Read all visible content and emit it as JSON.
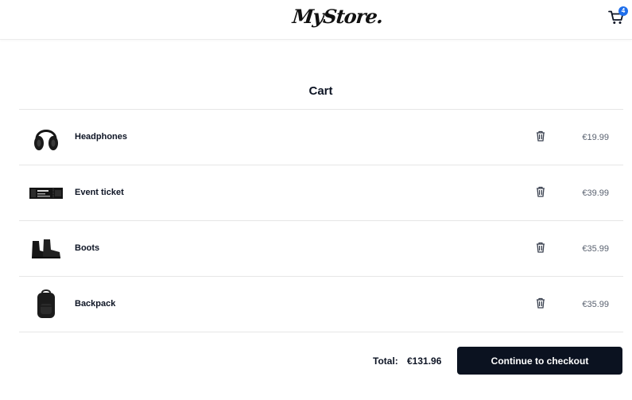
{
  "header": {
    "logo_main": "MyStore",
    "logo_dot": ".",
    "cart_count": "4",
    "cart_icon": "shopping-cart-icon"
  },
  "cart": {
    "title": "Cart",
    "items": [
      {
        "name": "Headphones",
        "price": "€19.99",
        "image": "headphones"
      },
      {
        "name": "Event ticket",
        "price": "€39.99",
        "image": "ticket"
      },
      {
        "name": "Boots",
        "price": "€35.99",
        "image": "boots"
      },
      {
        "name": "Backpack",
        "price": "€35.99",
        "image": "backpack"
      }
    ],
    "remove_icon": "trash-icon"
  },
  "summary": {
    "total_label": "Total:",
    "total_value": "€131.96",
    "checkout_label": "Continue to checkout"
  },
  "colors": {
    "primary_dark": "#0b1220",
    "badge": "#1f6feb",
    "divider": "#e6e6e6",
    "price_text": "#5a6270"
  }
}
